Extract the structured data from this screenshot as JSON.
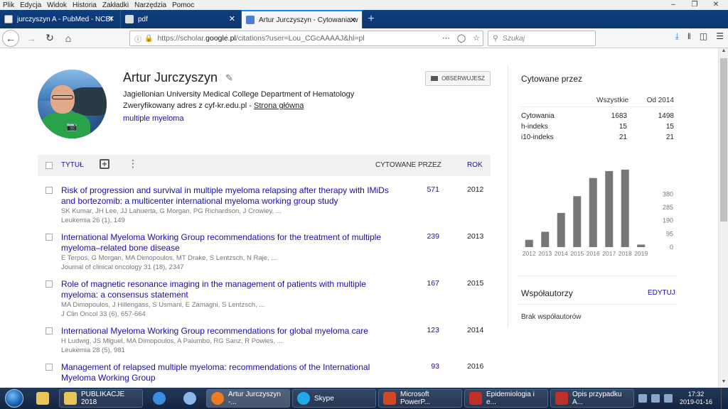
{
  "menubar": {
    "items": [
      "Plik",
      "Edycja",
      "Widok",
      "Historia",
      "Zakładki",
      "Narzędzia",
      "Pomoc"
    ]
  },
  "tabs": [
    {
      "label": "jurczyszyn A - PubMed - NCBI",
      "icon": "ncbi-icon"
    },
    {
      "label": "pdf",
      "icon": "pdf-doc-icon"
    },
    {
      "label": "Artur Jurczyszyn - Cytowania w",
      "icon": "scholar-icon",
      "active": true
    }
  ],
  "navbar": {
    "url_prefix": "https://scholar.",
    "url_domain": "google.pl",
    "url_suffix": "/citations?user=Lou_CGcAAAAJ&hl=pl",
    "search_placeholder": "Szukaj"
  },
  "profile": {
    "name": "Artur Jurczyszyn",
    "affiliation": "Jagiellonian University Medical College Department of Hematology",
    "verified": "Zweryfikowany adres z cyf-kr.edu.pl - ",
    "homepage": "Strona główna",
    "interest": "multiple myeloma",
    "follow_label": "OBSERWUJESZ"
  },
  "table": {
    "col_title": "TYTUŁ",
    "col_cited": "CYTOWANE PRZEZ",
    "col_year": "ROK"
  },
  "articles": [
    {
      "title": "Risk of progression and survival in multiple myeloma relapsing after therapy with IMiDs and bortezomib: a multicenter international myeloma working group study",
      "authors": "SK Kumar, JH Lee, JJ Lahuerta, G Morgan, PG Richardson, J Crowley, ...",
      "journal": "Leukemia 26 (1), 149",
      "cited": "571",
      "year": "2012"
    },
    {
      "title": "International Myeloma Working Group recommendations for the treatment of multiple myeloma–related bone disease",
      "authors": "E Terpos, G Morgan, MA Dimopoulos, MT Drake, S Lentzsch, N Raje, ...",
      "journal": "Journal of clinical oncology 31 (18), 2347",
      "cited": "239",
      "year": "2013"
    },
    {
      "title": "Role of magnetic resonance imaging in the management of patients with multiple myeloma: a consensus statement",
      "authors": "MA Dimopoulos, J Hillengass, S Usmani, E Zamagni, S Lentzsch, ...",
      "journal": "J Clin Oncol 33 (6), 657-664",
      "cited": "167",
      "year": "2015"
    },
    {
      "title": "International Myeloma Working Group recommendations for global myeloma care",
      "authors": "H Ludwig, JS Miguel, MA Dimopoulos, A Palumbo, RG Sanz, R Powles, ...",
      "journal": "Leukemia 28 (5), 981",
      "cited": "123",
      "year": "2014"
    },
    {
      "title": "Management of relapsed multiple myeloma: recommendations of the International Myeloma Working Group",
      "authors": "",
      "journal": "",
      "cited": "93",
      "year": "2016"
    }
  ],
  "sidebar": {
    "cited_by_title": "Cytowane przez",
    "hdr_all": "Wszystkie",
    "hdr_since": "Od 2014",
    "stats": [
      {
        "label": "Cytowania",
        "all": "1683",
        "since": "1498"
      },
      {
        "label": "h-indeks",
        "all": "15",
        "since": "15"
      },
      {
        "label": "i10-indeks",
        "all": "21",
        "since": "21"
      }
    ],
    "coauthors_title": "Współautorzy",
    "coauthors_edit": "EDYTUJ",
    "coauthors_none": "Brak współautorów"
  },
  "chart_data": {
    "type": "bar",
    "categories": [
      "2012",
      "2013",
      "2014",
      "2015",
      "2016",
      "2017",
      "2018",
      "2019"
    ],
    "values": [
      52,
      110,
      245,
      365,
      495,
      545,
      555,
      18
    ],
    "yticks": [
      0,
      95,
      190,
      285,
      380
    ],
    "ylim": [
      0,
      570
    ],
    "color": "#777777"
  },
  "taskbar": {
    "items": [
      {
        "label": "",
        "icon": "folder-icon",
        "type": "icononly"
      },
      {
        "label": "PUBLIKACJE 2018",
        "icon": "folder-icon",
        "type": "wide"
      },
      {
        "label": "",
        "icon": "ie-icon",
        "type": "icononly"
      },
      {
        "label": "",
        "icon": "thunderbird-icon",
        "type": "icononly"
      },
      {
        "label": "Artur Jurczyszyn -...",
        "icon": "firefox-icon",
        "type": "wide",
        "active": true
      },
      {
        "label": "Skype",
        "icon": "skype-icon",
        "type": "wide"
      },
      {
        "label": "Microsoft PowerP...",
        "icon": "powerpoint-icon",
        "type": "wide"
      },
      {
        "label": "Epidemiologia i e...",
        "icon": "pdf-icon",
        "type": "wide"
      },
      {
        "label": "Opis przypadku A...",
        "icon": "pdf-icon",
        "type": "wide"
      }
    ],
    "time": "17:32",
    "date": "2019-01-16"
  }
}
